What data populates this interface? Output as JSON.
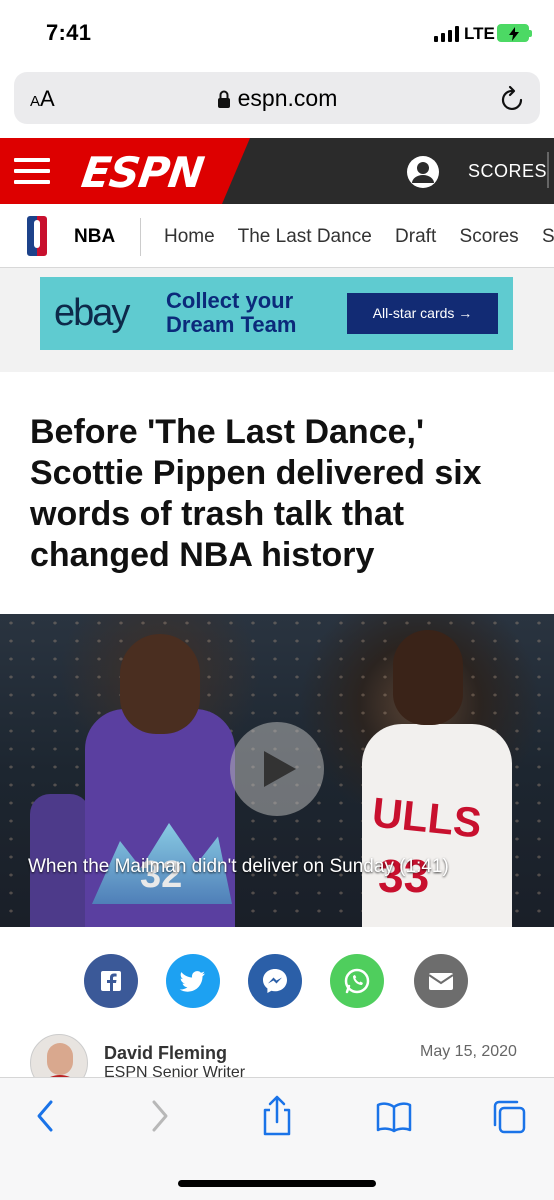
{
  "status_bar": {
    "time": "7:41",
    "network": "LTE",
    "battery_color": "#4cd964"
  },
  "browser": {
    "text_size_label_small": "A",
    "text_size_label_large": "A",
    "url": "espn.com",
    "icons": [
      "lock-icon",
      "reload-icon"
    ]
  },
  "espn_nav": {
    "logo": "ESPN",
    "scores_label": "SCORES",
    "brand_red": "#dd0000",
    "bar_color": "#2b2b2b"
  },
  "subnav": {
    "title": "NBA",
    "links": [
      "Home",
      "The Last Dance",
      "Draft",
      "Scores",
      "S"
    ]
  },
  "ad": {
    "logo": "ebay",
    "line1": "Collect your",
    "line2": "Dream Team",
    "button": "All-star cards →",
    "background": "#5fcbd0"
  },
  "article": {
    "headline": "Before 'The Last Dance,' Scottie Pippen delivered six words of trash talk that changed NBA history",
    "video_caption": "When the Mailman didn't deliver on Sunday (1:41)"
  },
  "share": {
    "buttons": [
      {
        "name": "facebook",
        "color": "#3b5998"
      },
      {
        "name": "twitter",
        "color": "#1da1f2"
      },
      {
        "name": "messenger",
        "color": "#2b5fa8"
      },
      {
        "name": "whatsapp",
        "color": "#4fce5d"
      },
      {
        "name": "email",
        "color": "#6d6d6d"
      }
    ]
  },
  "author": {
    "name": "David Fleming",
    "role": "ESPN Senior Writer",
    "date": "May 15, 2020"
  },
  "toolbar": {
    "icons": [
      "back-icon",
      "forward-icon",
      "share-icon",
      "bookmarks-icon",
      "tabs-icon"
    ],
    "accent": "#1a73e8"
  }
}
